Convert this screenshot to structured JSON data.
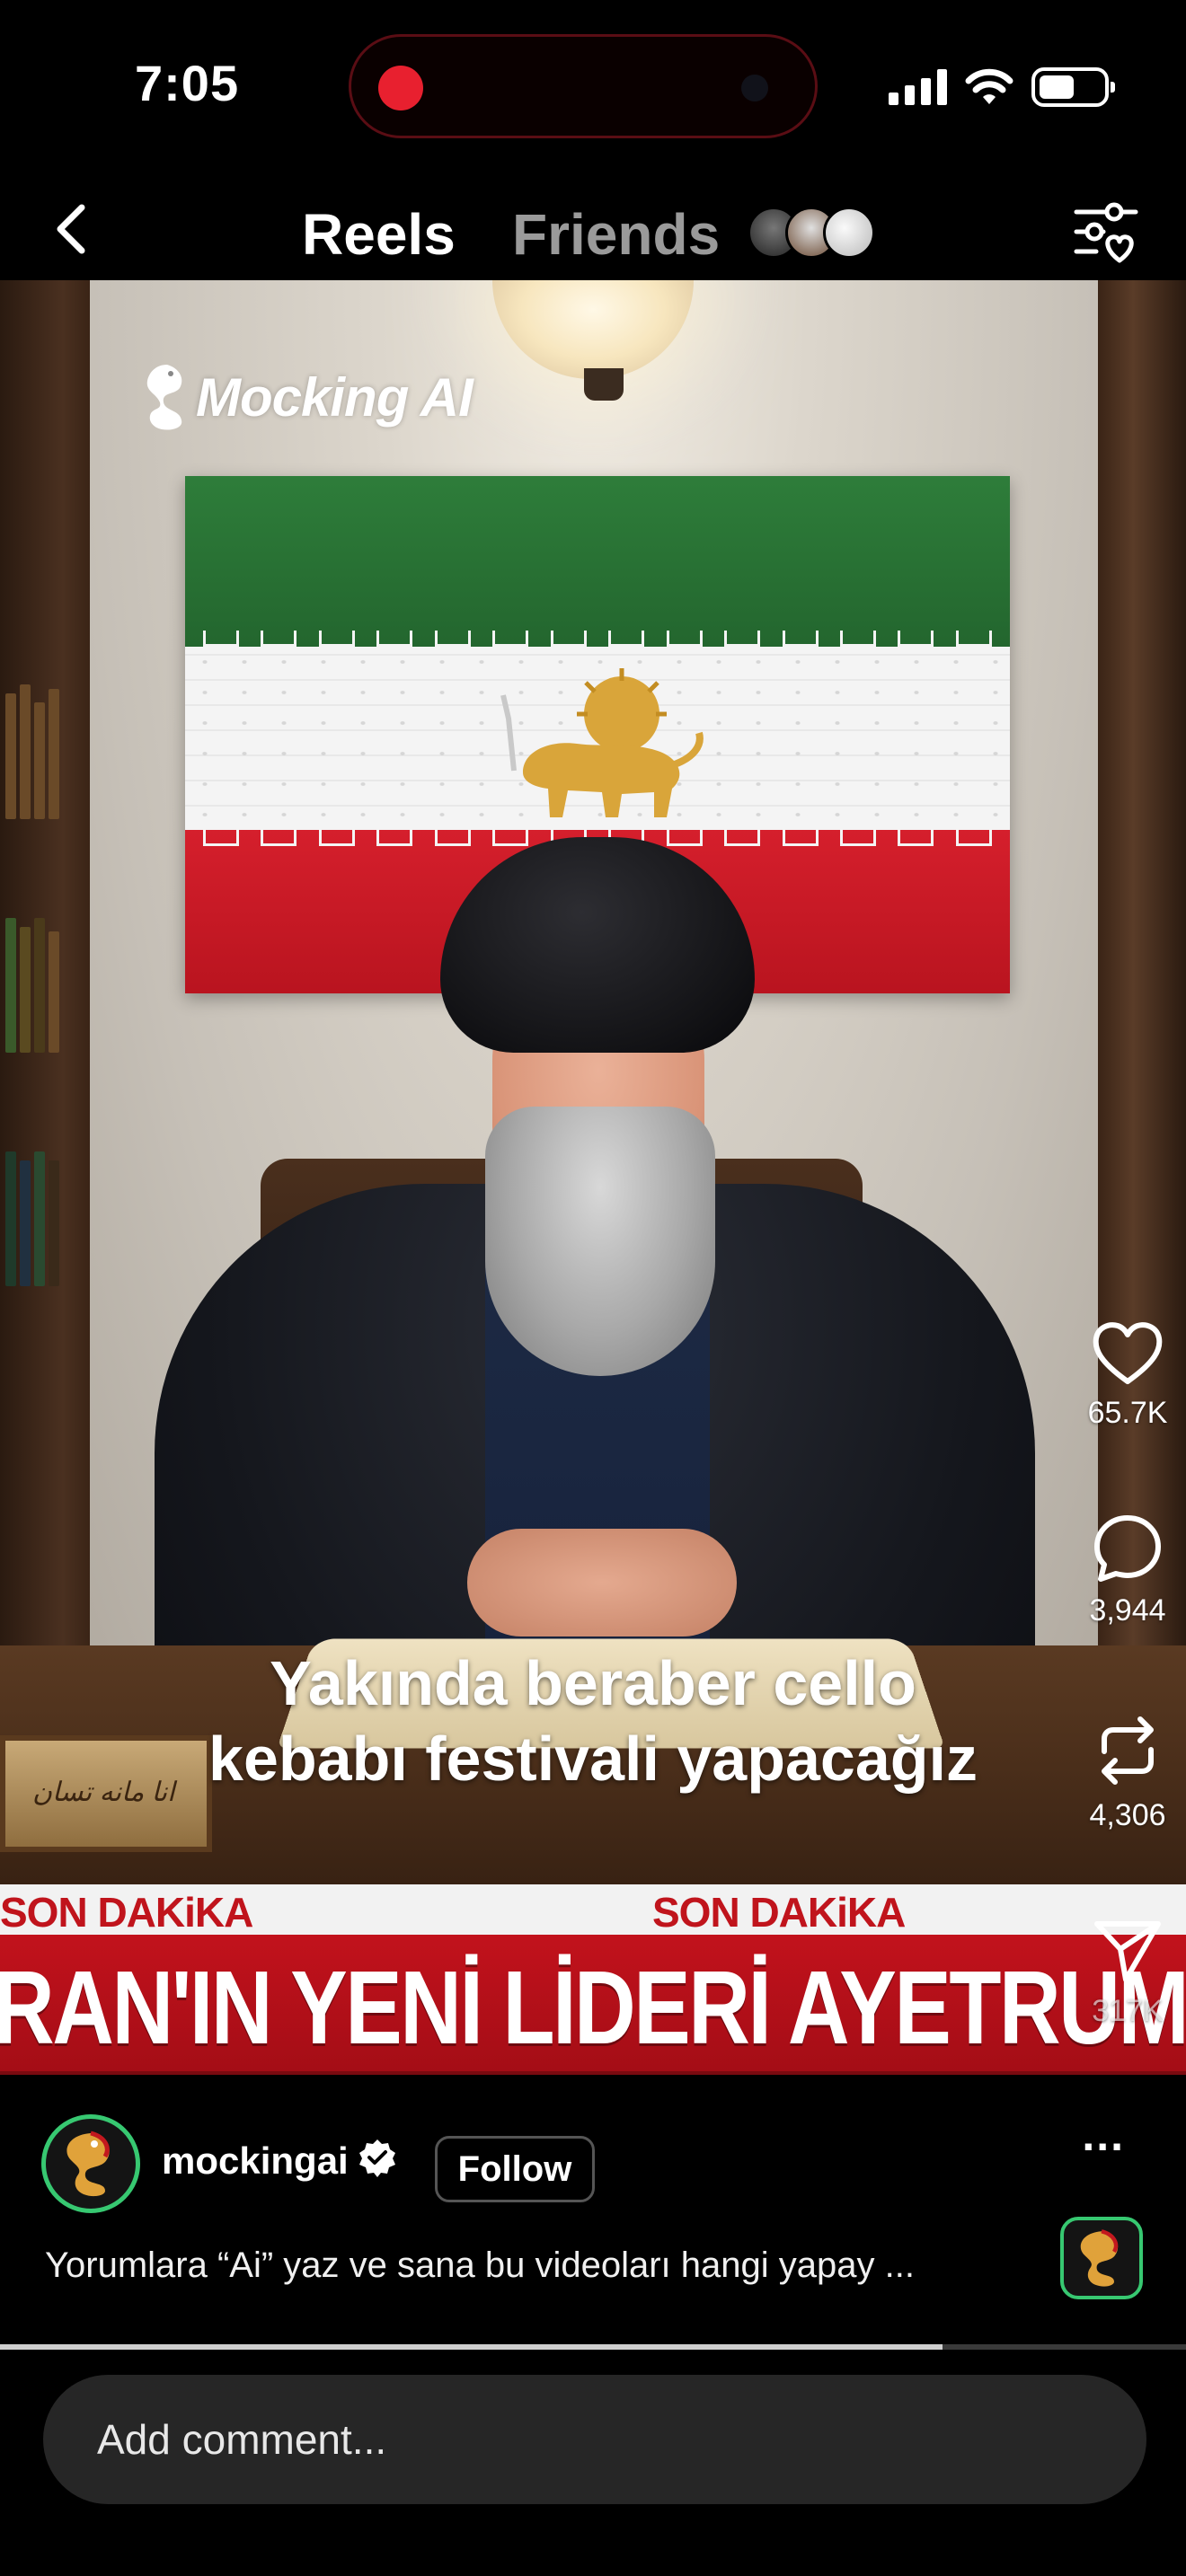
{
  "status_bar": {
    "time": "7:05"
  },
  "nav": {
    "tabs": [
      {
        "label": "Reels",
        "active": true
      },
      {
        "label": "Friends",
        "active": false
      }
    ]
  },
  "video": {
    "watermark": "Mocking AI",
    "caption": "Yakında beraber cello kebabı festivali yapacağız",
    "nameplate": "انا مانه تسان",
    "news_labels": [
      "SON DAKiKA",
      "SON DAKiKA"
    ],
    "headline": "RAN'IN YENİ LİDERİ AYETRUMP OLDU",
    "progress_fraction": 0.795
  },
  "actions": {
    "likes": "65.7K",
    "comments": "3,944",
    "reposts": "4,306",
    "shares": "317K"
  },
  "post": {
    "username": "mockingai",
    "follow_label": "Follow",
    "more": "...",
    "description": "Yorumlara “Ai” yaz ve sana bu videoları hangi yapay ..."
  },
  "comment": {
    "placeholder": "Add comment..."
  },
  "colors": {
    "accent_green": "#37c871",
    "news_red": "#c2121c"
  }
}
